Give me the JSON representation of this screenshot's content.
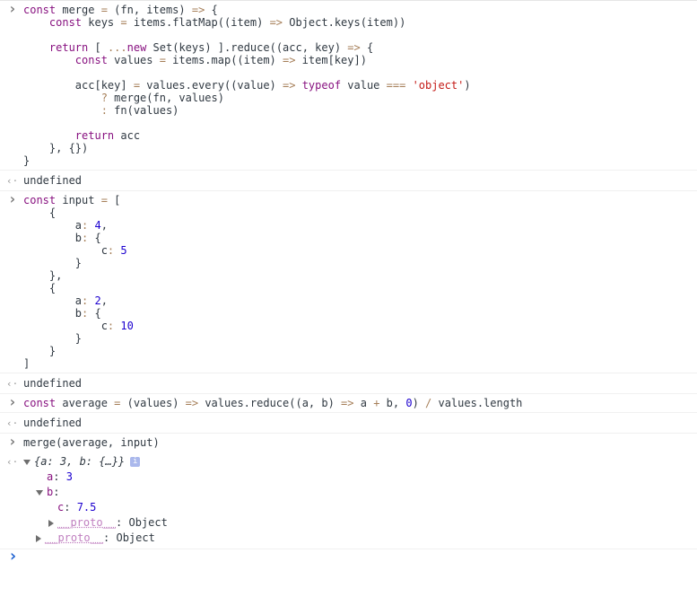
{
  "entries": [
    {
      "kind": "input",
      "code": "const merge = (fn, items) => {\n    const keys = items.flatMap((item) => Object.keys(item))\n\n    return [ ...new Set(keys) ].reduce((acc, key) => {\n        const values = items.map((item) => item[key])\n\n        acc[key] = values.every((value) => typeof value === 'object')\n            ? merge(fn, values)\n            : fn(values)\n\n        return acc\n    }, {})\n}"
    },
    {
      "kind": "output",
      "text": "undefined"
    },
    {
      "kind": "input",
      "code": "const input = [\n    {\n        a: 4,\n        b: {\n            c: 5\n        }\n    },\n    {\n        a: 2,\n        b: {\n            c: 10\n        }\n    }\n]"
    },
    {
      "kind": "output",
      "text": "undefined"
    },
    {
      "kind": "input",
      "code": "const average = (values) => values.reduce((a, b) => a + b, 0) / values.length"
    },
    {
      "kind": "output",
      "text": "undefined"
    },
    {
      "kind": "input",
      "code": "merge(average, input)"
    }
  ],
  "result": {
    "preview": "{a: 3, b: {…}}",
    "info_badge": "i",
    "a_key": "a",
    "a_value": "3",
    "b_key": "b",
    "c_key": "c",
    "c_value": "7.5",
    "inner_proto_key": "__proto__",
    "inner_proto_value": "Object",
    "outer_proto_key": "__proto__",
    "outer_proto_value": "Object"
  },
  "colors": {
    "keyword": "#881280",
    "string": "#c41a16",
    "number": "#1c00cf",
    "prompt": "#1a5fd0"
  }
}
